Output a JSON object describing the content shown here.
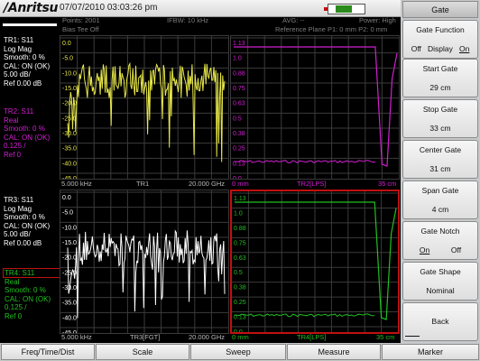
{
  "titlebar": {
    "logo_bold": "/Anritsu",
    "datetime": "07/07/2010 03:03:26 pm"
  },
  "status": {
    "points": "Points: 2001",
    "ifbw": "IFBW: 10 kHz",
    "avg": "AVG: --",
    "power": "Power: High",
    "bias_tee": "Bias Tee Off",
    "ref_plane": "Reference Plane P1: 0 mm P2: 0 mm"
  },
  "traces": [
    {
      "id": "TR1",
      "head": "TR1: S11",
      "lines": [
        "Log Mag",
        "Smooth: 0 %",
        "CAL: ON (OK)",
        "5.00 dB/",
        "Ref 0.00 dB"
      ],
      "color": "#ffffff"
    },
    {
      "id": "TR2",
      "head": "TR2: S11",
      "lines": [
        "Real",
        "Smooth: 0 %",
        "CAL: ON (OK)",
        "0.125 /",
        "Ref 0"
      ],
      "color": "#d020d0"
    },
    {
      "id": "TR3",
      "head": "TR3: S11",
      "lines": [
        "Log Mag",
        "Smooth: 0 %",
        "CAL: ON (OK)",
        "5.00 dB/",
        "Ref 0.00 dB"
      ],
      "color": "#ffffff"
    },
    {
      "id": "TR4",
      "head": "TR4: S11",
      "lines": [
        "Real",
        "Smooth: 0 %",
        "CAL: ON (OK)",
        "0.125 /",
        "Ref 0"
      ],
      "color": "#20c020"
    }
  ],
  "plots": {
    "tr1": {
      "yticks": [
        "0.0",
        "-5.0",
        "-10.0",
        "-15.0",
        "-20.0",
        "-25.0",
        "-30.0",
        "-35.0",
        "-40.0",
        "-45.0"
      ],
      "x_start": "5.000 kHz",
      "x_label": "TR1",
      "x_end": "20.000 GHz",
      "color": "#e8e84a"
    },
    "tr2": {
      "yticks": [
        "1.13",
        "1.0",
        "0.88",
        "0.75",
        "0.63",
        "0.5",
        "0.38",
        "0.25",
        "0.13",
        "0.0"
      ],
      "x_start": "0 mm",
      "x_label": "TR2[LPS]",
      "x_end": "35 cm",
      "color": "#d020d0"
    },
    "tr3": {
      "yticks": [
        "0.0",
        "-5.0",
        "-10.0",
        "-15.0",
        "-20.0",
        "-25.0",
        "-30.0",
        "-35.0",
        "-40.0",
        "-45.0"
      ],
      "x_start": "5.000 kHz",
      "x_label": "TR3[FGT]",
      "x_end": "20.000 GHz",
      "color": "#ffffff"
    },
    "tr4": {
      "yticks": [
        "1.13",
        "1.0",
        "0.88",
        "0.75",
        "0.63",
        "0.5",
        "0.38",
        "0.25",
        "0.13",
        "0.0"
      ],
      "x_start": "0 mm",
      "x_label": "TR4[LPS]",
      "x_end": "35 cm",
      "color": "#20c020"
    }
  },
  "menu": {
    "title": "Gate",
    "gate_function": {
      "label": "Gate Function",
      "opt_off": "Off",
      "opt_display": "Display",
      "opt_on": "On"
    },
    "start_gate": {
      "label": "Start Gate",
      "value": "29 cm"
    },
    "stop_gate": {
      "label": "Stop Gate",
      "value": "33 cm"
    },
    "center_gate": {
      "label": "Center Gate",
      "value": "31 cm"
    },
    "span_gate": {
      "label": "Span Gate",
      "value": "4 cm"
    },
    "gate_notch": {
      "label": "Gate Notch",
      "opt_on": "On",
      "opt_off": "Off"
    },
    "gate_shape": {
      "label": "Gate Shape",
      "value": "Nominal"
    },
    "back": {
      "label": "Back"
    }
  },
  "bottom_menu": [
    "Freq/Time/Dist",
    "Scale",
    "Sweep",
    "Measure",
    "Marker"
  ]
}
